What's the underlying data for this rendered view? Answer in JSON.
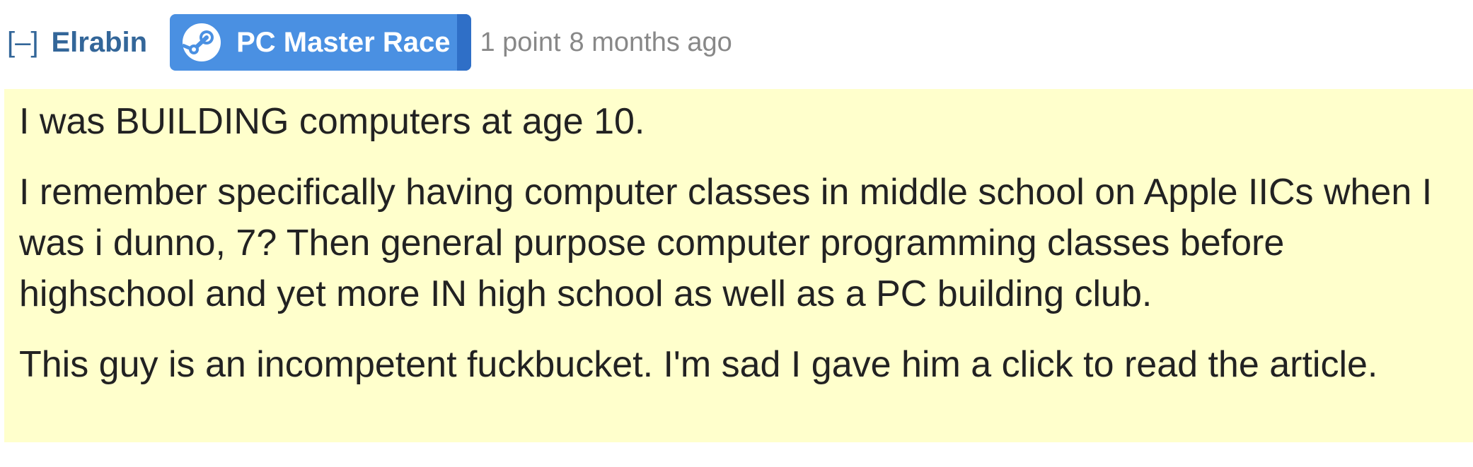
{
  "comment": {
    "collapse_label": "[–]",
    "author": "Elrabin",
    "flair": {
      "icon": "steam-icon",
      "text": "PC Master Race",
      "color": "#4a90e2"
    },
    "score": "1 point",
    "time": "8 months ago",
    "paragraphs": [
      "I was BUILDING computers at age 10.",
      "I remember specifically having computer classes in middle school on Apple IICs when I was i dunno, 7? Then general purpose computer programming classes before highschool and yet more IN high school as well as a PC building club.",
      "This guy is an incompetent fuckbucket. I'm sad I gave him a click to read the article."
    ],
    "highlight_color": "#ffffcc"
  }
}
